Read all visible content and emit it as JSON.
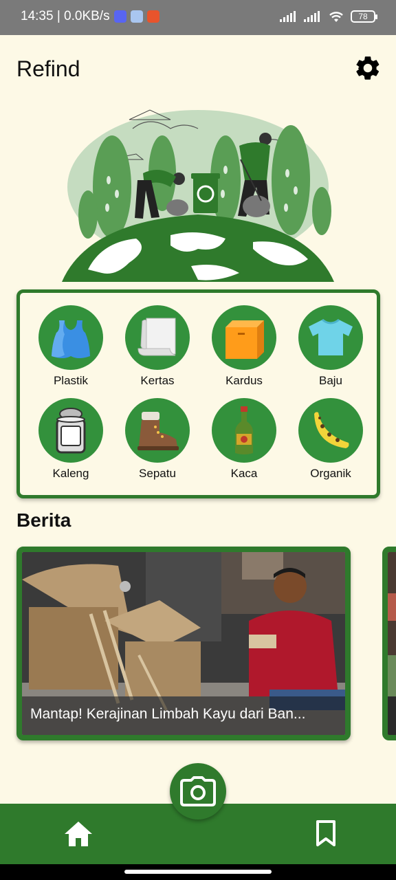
{
  "status_bar": {
    "time_speed": "14:35 | 0.0KB/s",
    "battery": "78",
    "icons": [
      "discord-icon",
      "app-icon",
      "shopee-icon",
      "signal-icon",
      "signal-icon",
      "wifi-icon",
      "battery-icon"
    ]
  },
  "header": {
    "title": "Refind",
    "settings_icon": "gear-icon"
  },
  "hero": {
    "illustration": "recycling-earth-illustration"
  },
  "categories": [
    {
      "label": "Plastik",
      "icon": "plastic-bag-icon"
    },
    {
      "label": "Kertas",
      "icon": "paper-icon"
    },
    {
      "label": "Kardus",
      "icon": "cardboard-box-icon"
    },
    {
      "label": "Baju",
      "icon": "shirt-icon"
    },
    {
      "label": "Kaleng",
      "icon": "can-icon"
    },
    {
      "label": "Sepatu",
      "icon": "boot-icon"
    },
    {
      "label": "Kaca",
      "icon": "glass-bottle-icon"
    },
    {
      "label": "Organik",
      "icon": "banana-peel-icon"
    }
  ],
  "news": {
    "section_title": "Berita",
    "items": [
      {
        "caption": "Mantap! Kerajinan Limbah Kayu dari Ban..."
      }
    ]
  },
  "bottom_nav": {
    "home_icon": "home-icon",
    "bookmark_icon": "bookmark-icon",
    "camera_icon": "camera-icon"
  },
  "colors": {
    "background": "#fdf9e6",
    "primary_green": "#2f7a2c",
    "circle_green": "#33913c",
    "status_bar": "#7a7a7a"
  }
}
